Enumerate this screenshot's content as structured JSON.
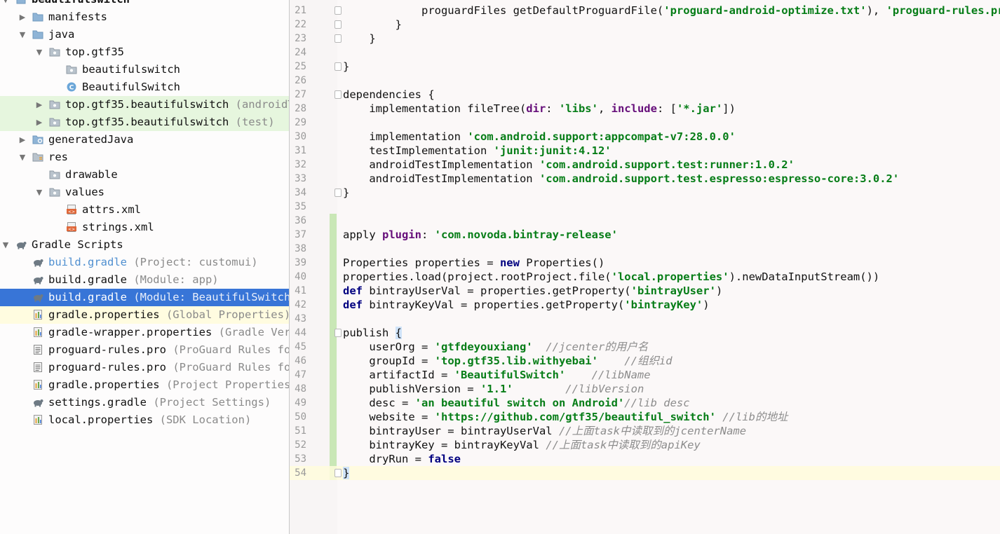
{
  "project_tree": {
    "items": [
      {
        "name": "tree-project-root",
        "label": "beautifulswitch",
        "hint": "",
        "icon": "module-icon",
        "arrow": "down",
        "indent": 0
      },
      {
        "name": "tree-folder-manifests",
        "label": "manifests",
        "hint": "",
        "icon": "folder-icon",
        "arrow": "right",
        "indent": 1
      },
      {
        "name": "tree-folder-java",
        "label": "java",
        "hint": "",
        "icon": "folder-icon",
        "arrow": "down",
        "indent": 1
      },
      {
        "name": "tree-package-top-gtf35",
        "label": "top.gtf35",
        "hint": "",
        "icon": "package-icon",
        "arrow": "down",
        "indent": 2
      },
      {
        "name": "tree-package-beautifulswitch",
        "label": "beautifulswitch",
        "hint": "",
        "icon": "package-icon",
        "arrow": "",
        "indent": 3
      },
      {
        "name": "tree-class-beautifulswitch",
        "label": "BeautifulSwitch",
        "hint": "",
        "icon": "class-icon",
        "arrow": "",
        "indent": 3
      },
      {
        "name": "tree-package-androidtest",
        "label": "top.gtf35.beautifulswitch",
        "hint": "(androidTest)",
        "icon": "package-icon",
        "arrow": "right",
        "indent": 2,
        "style": "green"
      },
      {
        "name": "tree-package-test",
        "label": "top.gtf35.beautifulswitch",
        "hint": "(test)",
        "icon": "package-icon",
        "arrow": "right",
        "indent": 2,
        "style": "green"
      },
      {
        "name": "tree-folder-generatedjava",
        "label": "generatedJava",
        "hint": "",
        "icon": "generated-folder-icon",
        "arrow": "right",
        "indent": 1
      },
      {
        "name": "tree-folder-res",
        "label": "res",
        "hint": "",
        "icon": "res-folder-icon",
        "arrow": "down",
        "indent": 1
      },
      {
        "name": "tree-folder-drawable",
        "label": "drawable",
        "hint": "",
        "icon": "package-icon",
        "arrow": "",
        "indent": 2
      },
      {
        "name": "tree-folder-values",
        "label": "values",
        "hint": "",
        "icon": "package-icon",
        "arrow": "down",
        "indent": 2
      },
      {
        "name": "tree-file-attrs-xml",
        "label": "attrs.xml",
        "hint": "",
        "icon": "xml-file-icon",
        "arrow": "",
        "indent": 3
      },
      {
        "name": "tree-file-strings-xml",
        "label": "strings.xml",
        "hint": "",
        "icon": "xml-file-icon",
        "arrow": "",
        "indent": 3
      },
      {
        "name": "tree-gradle-scripts",
        "label": "Gradle Scripts",
        "hint": "",
        "icon": "gradle-icon",
        "arrow": "down",
        "indent": 0
      },
      {
        "name": "tree-build-gradle-project",
        "label": "build.gradle",
        "hint": "(Project: customui)",
        "icon": "gradle-icon",
        "arrow": "",
        "indent": 1,
        "style": "link"
      },
      {
        "name": "tree-build-gradle-app",
        "label": "build.gradle",
        "hint": "(Module: app)",
        "icon": "gradle-icon",
        "arrow": "",
        "indent": 1
      },
      {
        "name": "tree-build-gradle-module",
        "label": "build.gradle",
        "hint": "(Module: BeautifulSwitch)",
        "icon": "gradle-icon",
        "arrow": "",
        "indent": 1,
        "style": "sel"
      },
      {
        "name": "tree-gradle-properties-global",
        "label": "gradle.properties",
        "hint": "(Global Properties)",
        "icon": "properties-file-icon",
        "arrow": "",
        "indent": 1,
        "style": "yel"
      },
      {
        "name": "tree-gradle-wrapper-properties",
        "label": "gradle-wrapper.properties",
        "hint": "(Gradle Version)",
        "icon": "properties-file-icon",
        "arrow": "",
        "indent": 1
      },
      {
        "name": "tree-proguard-rules-1",
        "label": "proguard-rules.pro",
        "hint": "(ProGuard Rules for",
        "icon": "text-file-icon",
        "arrow": "",
        "indent": 1
      },
      {
        "name": "tree-proguard-rules-2",
        "label": "proguard-rules.pro",
        "hint": "(ProGuard Rules for",
        "icon": "text-file-icon",
        "arrow": "",
        "indent": 1
      },
      {
        "name": "tree-gradle-properties-project",
        "label": "gradle.properties",
        "hint": "(Project Properties)",
        "icon": "properties-file-icon",
        "arrow": "",
        "indent": 1
      },
      {
        "name": "tree-settings-gradle",
        "label": "settings.gradle",
        "hint": "(Project Settings)",
        "icon": "gradle-icon",
        "arrow": "",
        "indent": 1
      },
      {
        "name": "tree-local-properties",
        "label": "local.properties",
        "hint": "(SDK Location)",
        "icon": "properties-file-icon",
        "arrow": "",
        "indent": 1
      }
    ]
  },
  "editor": {
    "lines": [
      {
        "n": "21",
        "fold": true,
        "parts": [
          [
            "",
            "            proguardFiles getDefaultProguardFile("
          ],
          [
            "str",
            "'proguard-android-optimize.txt'"
          ],
          [
            "",
            "), "
          ],
          [
            "str",
            "'proguard-rules.pro'"
          ]
        ]
      },
      {
        "n": "22",
        "fold": true,
        "parts": [
          [
            "",
            "        }"
          ]
        ]
      },
      {
        "n": "23",
        "fold": true,
        "parts": [
          [
            "",
            "    }"
          ]
        ]
      },
      {
        "n": "24",
        "parts": []
      },
      {
        "n": "25",
        "fold": true,
        "parts": [
          [
            "",
            "}"
          ]
        ]
      },
      {
        "n": "26",
        "parts": []
      },
      {
        "n": "27",
        "fold": true,
        "parts": [
          [
            "",
            "dependencies {"
          ]
        ]
      },
      {
        "n": "28",
        "parts": [
          [
            "",
            "    implementation fileTree("
          ],
          [
            "nm",
            "dir"
          ],
          [
            "",
            ": "
          ],
          [
            "str",
            "'libs'"
          ],
          [
            "",
            ", "
          ],
          [
            "nm",
            "include"
          ],
          [
            "",
            ": ["
          ],
          [
            "str",
            "'*.jar'"
          ],
          [
            "",
            "])"
          ]
        ]
      },
      {
        "n": "29",
        "parts": []
      },
      {
        "n": "30",
        "parts": [
          [
            "",
            "    implementation "
          ],
          [
            "str",
            "'com.android.support:appcompat-v7:28.0.0'"
          ]
        ]
      },
      {
        "n": "31",
        "parts": [
          [
            "",
            "    testImplementation "
          ],
          [
            "str",
            "'junit:junit:4.12'"
          ]
        ]
      },
      {
        "n": "32",
        "parts": [
          [
            "",
            "    androidTestImplementation "
          ],
          [
            "str",
            "'com.android.support.test:runner:1.0.2'"
          ]
        ]
      },
      {
        "n": "33",
        "parts": [
          [
            "",
            "    androidTestImplementation "
          ],
          [
            "str",
            "'com.android.support.test.espresso:espresso-core:3.0.2'"
          ]
        ]
      },
      {
        "n": "34",
        "fold": true,
        "parts": [
          [
            "",
            "}"
          ]
        ]
      },
      {
        "n": "35",
        "parts": []
      },
      {
        "n": "36",
        "parts": []
      },
      {
        "n": "37",
        "parts": [
          [
            "",
            "apply "
          ],
          [
            "nm",
            "plugin"
          ],
          [
            "",
            ": "
          ],
          [
            "str",
            "'com.novoda.bintray-release'"
          ]
        ]
      },
      {
        "n": "38",
        "parts": []
      },
      {
        "n": "39",
        "parts": [
          [
            "",
            "Properties properties = "
          ],
          [
            "kw",
            "new"
          ],
          [
            "",
            " Properties()"
          ]
        ]
      },
      {
        "n": "40",
        "parts": [
          [
            "",
            "properties.load(project.rootProject.file("
          ],
          [
            "str",
            "'local.properties'"
          ],
          [
            "",
            ").newDataInputStream())"
          ]
        ]
      },
      {
        "n": "41",
        "parts": [
          [
            "kw",
            "def"
          ],
          [
            "",
            " bintrayUserVal = properties.getProperty("
          ],
          [
            "str",
            "'bintrayUser'"
          ],
          [
            "",
            ")"
          ]
        ]
      },
      {
        "n": "42",
        "parts": [
          [
            "kw",
            "def"
          ],
          [
            "",
            " bintrayKeyVal = properties.getProperty("
          ],
          [
            "str",
            "'bintrayKey'"
          ],
          [
            "",
            ")"
          ]
        ]
      },
      {
        "n": "43",
        "parts": []
      },
      {
        "n": "44",
        "fold": true,
        "parts": [
          [
            "",
            "publish "
          ],
          [
            "brm",
            "{"
          ]
        ]
      },
      {
        "n": "45",
        "parts": [
          [
            "",
            "    userOrg = "
          ],
          [
            "str",
            "'gtfdeyouxiang'"
          ],
          [
            "",
            "  "
          ],
          [
            "cmt",
            "//jcenter的用户名"
          ]
        ]
      },
      {
        "n": "46",
        "parts": [
          [
            "",
            "    groupId = "
          ],
          [
            "str",
            "'top.gtf35.lib.withyebai'"
          ],
          [
            "",
            "    "
          ],
          [
            "cmt",
            "//组织id"
          ]
        ]
      },
      {
        "n": "47",
        "parts": [
          [
            "",
            "    artifactId = "
          ],
          [
            "str",
            "'BeautifulSwitch'"
          ],
          [
            "",
            "    "
          ],
          [
            "cmt",
            "//libName"
          ]
        ]
      },
      {
        "n": "48",
        "parts": [
          [
            "",
            "    publishVersion = "
          ],
          [
            "str",
            "'1.1'"
          ],
          [
            "",
            "        "
          ],
          [
            "cmt",
            "//libVersion"
          ]
        ]
      },
      {
        "n": "49",
        "parts": [
          [
            "",
            "    desc = "
          ],
          [
            "str",
            "'an beautiful switch on Android'"
          ],
          [
            "cmt",
            "//lib desc"
          ]
        ]
      },
      {
        "n": "50",
        "parts": [
          [
            "",
            "    website = "
          ],
          [
            "str",
            "'https://github.com/gtf35/beautiful_switch'"
          ],
          [
            "",
            " "
          ],
          [
            "cmt",
            "//lib的地址"
          ]
        ]
      },
      {
        "n": "51",
        "parts": [
          [
            "",
            "    bintrayUser = bintrayUserVal "
          ],
          [
            "cmt",
            "//上面task中读取到的jcenterName"
          ]
        ]
      },
      {
        "n": "52",
        "parts": [
          [
            "",
            "    bintrayKey = bintrayKeyVal "
          ],
          [
            "cmt",
            "//上面task中读取到的apiKey"
          ]
        ]
      },
      {
        "n": "53",
        "parts": [
          [
            "",
            "    dryRun = "
          ],
          [
            "kw",
            "false"
          ]
        ]
      },
      {
        "n": "54",
        "fold": true,
        "caret": true,
        "parts": [
          [
            "brm",
            "}"
          ]
        ]
      }
    ]
  }
}
